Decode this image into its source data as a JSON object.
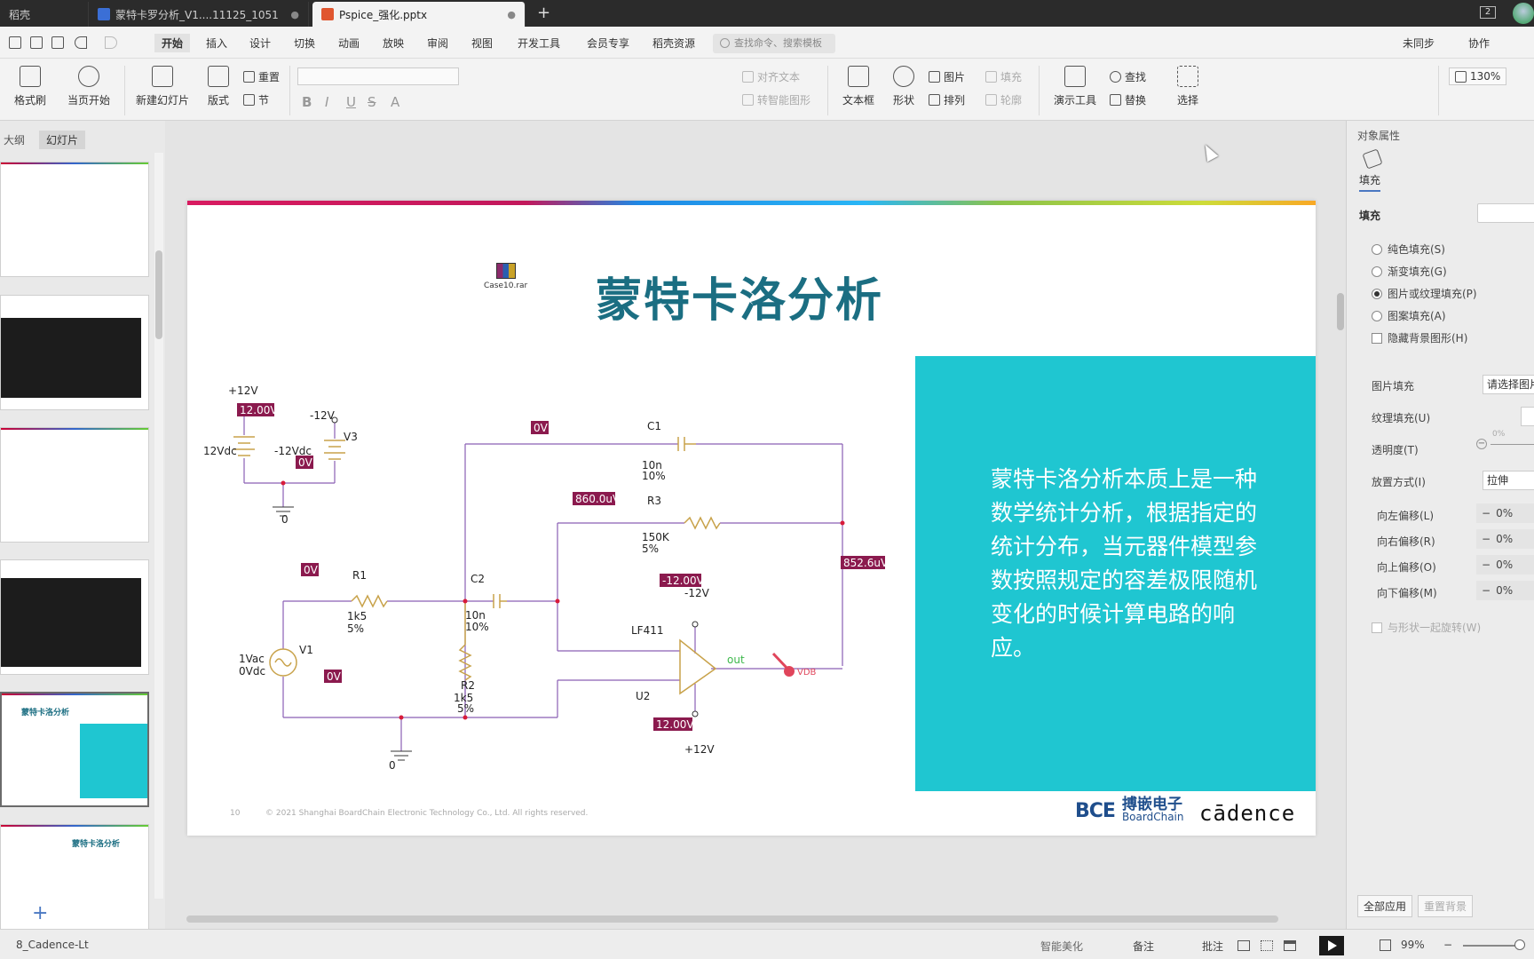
{
  "tabs": [
    {
      "label": "稻壳",
      "icon": "docer-icon",
      "color": "#444"
    },
    {
      "label": "蒙特卡罗分析_V1....11125_1051",
      "icon": "word-icon",
      "color": "#3b6fd6"
    },
    {
      "label": "Pspice_强化.pptx",
      "icon": "ppt-icon",
      "color": "#e0562f",
      "active": true
    }
  ],
  "window_badge": "2",
  "menu": [
    "开始",
    "插入",
    "设计",
    "切换",
    "动画",
    "放映",
    "审阅",
    "视图",
    "开发工具",
    "会员专享",
    "稻壳资源"
  ],
  "menu_search_placeholder": "查找命令、搜索模板",
  "menu_right": [
    "未同步",
    "协作"
  ],
  "ribbon": {
    "format_painter": "格式刷",
    "play_from_current": "当页开始",
    "new_slide": "新建幻灯片",
    "layout": "版式",
    "reset": "重置",
    "section": "节",
    "align_text": "对齐文本",
    "convert_smartart": "转智能图形",
    "textbox": "文本框",
    "shape": "形状",
    "picture": "图片",
    "fill": "填充",
    "arrange": "排列",
    "outline": "轮廓",
    "present_tools": "演示工具",
    "find": "查找",
    "replace": "替换",
    "select": "选择",
    "zoom": "130%"
  },
  "left_panel": {
    "tabs": [
      "大纲",
      "幻灯片"
    ],
    "thumb_titles": {
      "slide_sel": "蒙特卡洛分析",
      "slide_next": "蒙特卡洛分析"
    }
  },
  "slide": {
    "title": "蒙特卡洛分析",
    "attachment": "Case10.rar",
    "body": "蒙特卡洛分析本质上是一种数学统计分析，根据指定的统计分布，当元器件模型参数按照规定的容差极限随机变化的时候计算电路的响应。",
    "page_number": "10",
    "copyright": "© 2021 Shanghai BoardChain Electronic Technology Co., Ltd. All rights reserved.",
    "logo_bce": "BCE",
    "logo_cn": "搏嵌电子",
    "logo_en": "BoardChain",
    "logo_cadence": "cādence"
  },
  "circuit": {
    "p12": "+12V",
    "m12": "-12V",
    "v3": "V3",
    "vdc12": "12Vdc",
    "mvdc12": "-12Vdc",
    "gnd0a": "0",
    "gnd0b": "0",
    "c1": "C1",
    "c1v": "10n",
    "c1t": "10%",
    "r3": "R3",
    "r3v": "150K",
    "r3t": "5%",
    "r1": "R1",
    "r1v": "1k5",
    "r1t": "5%",
    "c2": "C2",
    "c2v": "10n",
    "c2t": "10%",
    "r2": "R2",
    "r2v": "1k5",
    "r2t": "5%",
    "v1": "V1",
    "v1ac": "1Vac",
    "v1dc": "0Vdc",
    "opamp": "LF411",
    "u2": "U2",
    "opm12": "-12V",
    "opp12": "+12V",
    "out": "out",
    "vdb": "VDB",
    "labels": {
      "l12v": "12.00V",
      "l0v_a": "0V",
      "l0v_b": "0V",
      "l860": "860.0uV",
      "l0v_c": "0V",
      "l0v_d": "0V",
      "lm12": "-12.00V",
      "l852": "852.6uV",
      "l12v_b": "12.00V"
    }
  },
  "right_panel": {
    "header": "对象属性",
    "tab": "填充",
    "section": "填充",
    "options": [
      "纯色填充(S)",
      "渐变填充(G)",
      "图片或纹理填充(P)",
      "图案填充(A)"
    ],
    "selected_option": "图片或纹理填充(P)",
    "hide_bg": "隐藏背景图形(H)",
    "picture_fill": "图片填充",
    "picture_fill_value": "请选择图片",
    "texture_fill": "纹理填充(U)",
    "transparency": "透明度(T)",
    "transparency_value": "0%",
    "placement": "放置方式(I)",
    "placement_value": "拉伸",
    "offsets": [
      {
        "label": "向左偏移(L)",
        "value": "0%"
      },
      {
        "label": "向右偏移(R)",
        "value": "0%"
      },
      {
        "label": "向上偏移(O)",
        "value": "0%"
      },
      {
        "label": "向下偏移(M)",
        "value": "0%"
      }
    ],
    "rotate_with_shape": "与形状一起旋转(W)",
    "apply_all": "全部应用",
    "reset_bg": "重置背景"
  },
  "status": {
    "theme": "8_Cadence-Lt",
    "beautify": "智能美化",
    "notes": "备注",
    "comments": "批注",
    "zoom": "99%"
  }
}
